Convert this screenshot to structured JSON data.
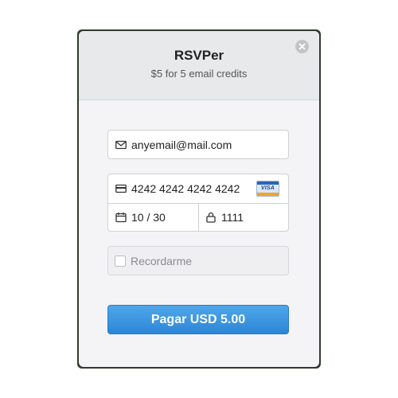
{
  "header": {
    "title": "RSVPer",
    "subtitle": "$5 for 5 email credits"
  },
  "form": {
    "email": {
      "value": "anyemail@mail.com",
      "icon": "envelope-icon"
    },
    "card_number": {
      "value": "4242 4242 4242 4242",
      "icon": "credit-card-icon",
      "brand": "VISA",
      "brand_icon": "visa-logo"
    },
    "expiry": {
      "value": "10 / 30",
      "icon": "calendar-icon"
    },
    "cvc": {
      "value": "1111",
      "icon": "lock-icon"
    },
    "remember": {
      "label": "Recordarme",
      "checked": false
    },
    "pay_button": {
      "label": "Pagar USD 5.00"
    }
  },
  "colors": {
    "accent": "#3a96e0",
    "header_bg": "#e8e9eb",
    "body_bg": "#f4f4f7"
  }
}
